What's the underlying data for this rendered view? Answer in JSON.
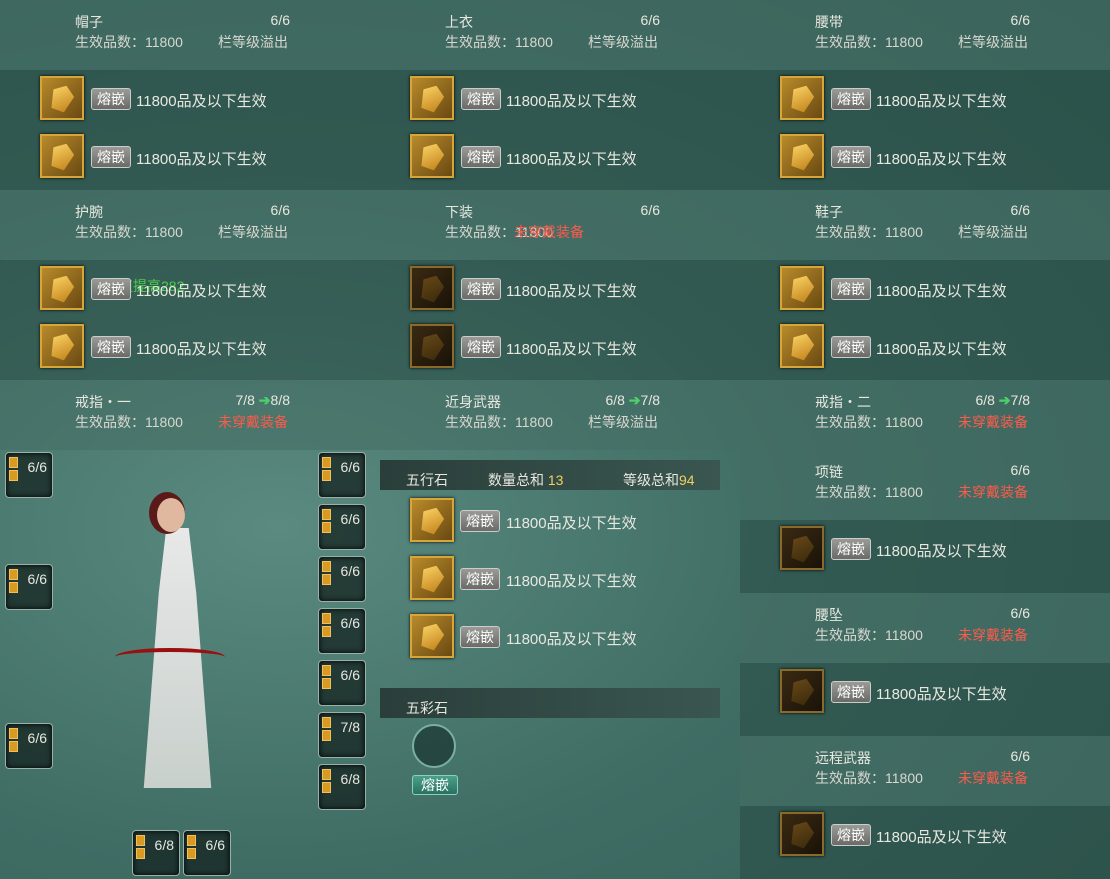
{
  "slots": [
    {
      "name": "帽子",
      "count": "6/6",
      "grade": "生效品数：11800",
      "status": "栏等级溢出",
      "warn": false,
      "gems": [
        {
          "dark": false,
          "text": "11800品及以下生效"
        },
        {
          "dark": false,
          "text": "11800品及以下生效"
        }
      ]
    },
    {
      "name": "上衣",
      "count": "6/6",
      "grade": "生效品数：11800",
      "status": "栏等级溢出",
      "warn": false,
      "gems": [
        {
          "dark": false,
          "text": "11800品及以下生效"
        },
        {
          "dark": false,
          "text": "11800品及以下生效"
        }
      ]
    },
    {
      "name": "腰带",
      "count": "6/6",
      "grade": "生效品数：11800",
      "status": "栏等级溢出",
      "warn": false,
      "gems": [
        {
          "dark": false,
          "text": "11800品及以下生效"
        },
        {
          "dark": false,
          "text": "11800品及以下生效"
        }
      ]
    },
    {
      "name": "护腕",
      "count": "6/6",
      "grade": "生效品数：11800",
      "status": "栏等级溢出",
      "warn": false,
      "bonus": "破招值提高282",
      "gems": [
        {
          "dark": false,
          "text": "11800品及以下生效"
        },
        {
          "dark": false,
          "text": "11800品及以下生效"
        }
      ]
    },
    {
      "name": "下装",
      "count": "6/6",
      "grade": "生效品数：11800",
      "status": "未穿戴装备",
      "warn": true,
      "gems": [
        {
          "dark": true,
          "text": "11800品及以下生效"
        },
        {
          "dark": true,
          "text": "11800品及以下生效"
        }
      ]
    },
    {
      "name": "鞋子",
      "count": "6/6",
      "grade": "生效品数：11800",
      "status": "栏等级溢出",
      "warn": false,
      "gems": [
        {
          "dark": false,
          "text": "11800品及以下生效"
        },
        {
          "dark": false,
          "text": "11800品及以下生效"
        }
      ]
    }
  ],
  "row3": [
    {
      "name": "戒指・一",
      "count": "7/8",
      "next": "8/8",
      "grade": "生效品数：11800",
      "status": "未穿戴装备",
      "warn": true
    },
    {
      "name": "近身武器",
      "count": "6/8",
      "next": "7/8",
      "grade": "生效品数：11800",
      "status": "栏等级溢出",
      "warn": false
    },
    {
      "name": "戒指・二",
      "count": "6/8",
      "next": "7/8",
      "grade": "生效品数：11800",
      "status": "未穿戴装备",
      "warn": true
    }
  ],
  "right": [
    {
      "name": "项链",
      "count": "6/6",
      "grade": "生效品数：11800",
      "status": "未穿戴装备",
      "gem": "11800品及以下生效"
    },
    {
      "name": "腰坠",
      "count": "6/6",
      "grade": "生效品数：11800",
      "status": "未穿戴装备",
      "gem": "11800品及以下生效"
    },
    {
      "name": "远程武器",
      "count": "6/6",
      "grade": "生效品数：11800",
      "status": "未穿戴装备",
      "gem": "11800品及以下生效"
    }
  ],
  "inlay_label": "熔嵌",
  "wuxing": {
    "title": "五行石",
    "qty_label": "数量总和",
    "qty": "13",
    "lvl_label": "等级总和",
    "lvl": "94",
    "gems": [
      "11800品及以下生效",
      "11800品及以下生效",
      "11800品及以下生效"
    ]
  },
  "wucai": {
    "title": "五彩石",
    "button": "熔嵌"
  },
  "char_slots_left": [
    "6/6",
    "6/6",
    "6/6"
  ],
  "char_slots_right": [
    "6/6",
    "6/6",
    "6/6",
    "6/6",
    "6/6",
    "7/8",
    "6/8"
  ],
  "char_slots_bottom": [
    "6/8",
    "6/6"
  ],
  "colors": {
    "warn": "#ff5a4a",
    "bonus": "#4ad04a",
    "gold": "#d8a53a",
    "arrow": "#4cd06a"
  }
}
